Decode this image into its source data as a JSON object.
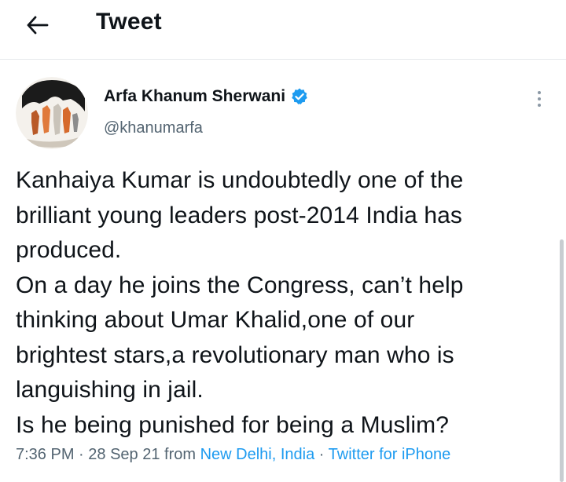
{
  "header": {
    "title": "Tweet",
    "back_icon": "arrow-left-icon"
  },
  "author": {
    "name": "Arfa Khanum Sherwani",
    "handle": "@khanumarfa",
    "verified": true,
    "verified_color": "#1d9bf0"
  },
  "tweet": {
    "lines": [
      "Kanhaiya Kumar is undoubtedly one of the",
      "brilliant young leaders post-2014 India has",
      "produced.",
      "On a day he joins the Congress, can’t help",
      "thinking about Umar Khalid,one of our",
      "brightest stars,a revolutionary man who is",
      "languishing in jail.",
      "Is he being punished for being a Muslim?"
    ]
  },
  "meta": {
    "time": "7:36 PM",
    "sep1": " · ",
    "date": "28 Sep 21",
    "from": " from ",
    "location": "New Delhi, India",
    "sep2": " · ",
    "source": "Twitter for iPhone"
  },
  "colors": {
    "text": "#0f1419",
    "secondary": "#536471",
    "link": "#1d9bf0"
  }
}
